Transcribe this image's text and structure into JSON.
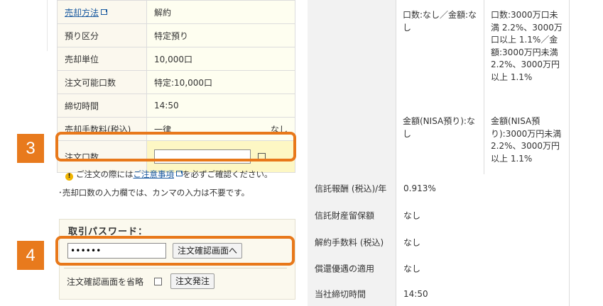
{
  "order_form": {
    "rows": [
      {
        "label": "売却方法",
        "value": "解約",
        "label_is_link": true
      },
      {
        "label": "預り区分",
        "value": "特定預り"
      },
      {
        "label": "売却単位",
        "value": "10,000口"
      },
      {
        "label": "注文可能口数",
        "value": "特定:10,000口"
      },
      {
        "label": "締切時間",
        "value": "14:50"
      },
      {
        "label": "売却手数料(税込)",
        "value": "一律",
        "extra": "なし"
      }
    ],
    "quantity": {
      "label": "注文口数",
      "value": "",
      "unit": "口"
    }
  },
  "badges": {
    "step3": "3",
    "step4": "4"
  },
  "notice": {
    "prefix": "ご注文の際には",
    "link": "ご注意事項",
    "suffix": "を必ずご確認ください。"
  },
  "note": "･売却口数の入力欄では、カンマの入力は不要です。",
  "password_panel": {
    "title": "取引パスワード：",
    "password_value": "••••••",
    "confirm_button": "注文確認画面へ",
    "skip_label": "注文確認画面を省略",
    "skip_checked": false,
    "submit_button": "注文発注"
  },
  "fee_info": {
    "col1_top": "口数:なし／金額:なし",
    "col2_top": "口数:3000万口未満 2.2%、3000万口以上 1.1%／金額:3000万円未満 2.2%、3000万円以上 1.1%",
    "col1_bottom": "金額(NISA預り):なし",
    "col2_bottom": "金額(NISA預り):3000万円未満 2.2%、3000万円以上 1.1%"
  },
  "info_rows": [
    {
      "label": "信託報酬 (税込)/年",
      "value": "0.913%"
    },
    {
      "label": "信託財産留保額",
      "value": "なし"
    },
    {
      "label": "解約手数料 (税込)",
      "value": "なし"
    },
    {
      "label": "償還優遇の適用",
      "value": "なし"
    },
    {
      "label": "当社締切時間",
      "value": "14:50"
    }
  ],
  "colors": {
    "highlight": "#e8781a",
    "badge": "#e87a1d",
    "link": "#1a5aa0"
  }
}
